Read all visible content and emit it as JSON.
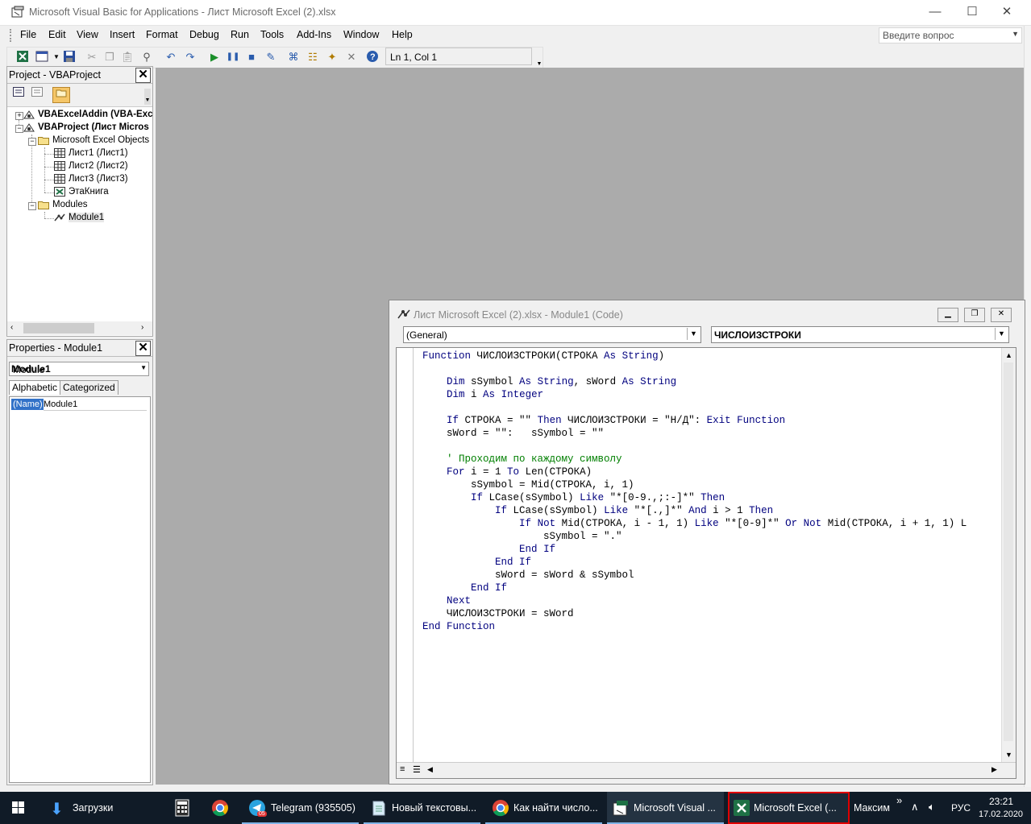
{
  "window": {
    "title": "Microsoft Visual Basic for Applications - Лист Microsoft Excel (2).xlsx",
    "minimize": "—",
    "maximize": "☐",
    "close": "✕"
  },
  "menu": {
    "items": [
      "File",
      "Edit",
      "View",
      "Insert",
      "Format",
      "Debug",
      "Run",
      "Tools",
      "Add-Ins",
      "Window",
      "Help"
    ],
    "help_placeholder": "Введите вопрос"
  },
  "toolbar": {
    "position": "Ln 1, Col 1"
  },
  "project": {
    "title": "Project - VBAProject",
    "tree": [
      {
        "label": "VBAExcelAddin (VBA-Exc",
        "bold": true,
        "level": 0
      },
      {
        "label": "VBAProject (Лист Micros",
        "bold": true,
        "level": 0
      },
      {
        "label": "Microsoft Excel Objects",
        "bold": false,
        "level": 1
      },
      {
        "label": "Лист1 (Лист1)",
        "bold": false,
        "level": 2
      },
      {
        "label": "Лист2 (Лист2)",
        "bold": false,
        "level": 2
      },
      {
        "label": "Лист3 (Лист3)",
        "bold": false,
        "level": 2
      },
      {
        "label": "ЭтаКнига",
        "bold": false,
        "level": 2
      },
      {
        "label": "Modules",
        "bold": false,
        "level": 1
      },
      {
        "label": "Module1",
        "bold": false,
        "level": 2
      }
    ]
  },
  "properties": {
    "title": "Properties - Module1",
    "object_name": "Module1",
    "object_type": "Module",
    "tabs": [
      "Alphabetic",
      "Categorized"
    ],
    "rows": [
      {
        "name": "(Name)",
        "value": "Module1"
      }
    ]
  },
  "code_window": {
    "title": "Лист Microsoft Excel (2).xlsx - Module1 (Code)",
    "object_combo": "(General)",
    "proc_combo": "ЧИСЛОИЗСТРОКИ",
    "lines": [
      "Function ЧИСЛОИЗСТРОКИ(СТРОКА As String)",
      "",
      "    Dim sSymbol As String, sWord As String",
      "    Dim i As Integer",
      "",
      "    If СТРОКА = \"\" Then ЧИСЛОИЗСТРОКИ = \"Н/Д\": Exit Function",
      "    sWord = \"\":   sSymbol = \"\"",
      "",
      "    ' Проходим по каждому символу",
      "    For i = 1 To Len(СТРОКА)",
      "        sSymbol = Mid(СТРОКА, i, 1)",
      "        If LCase(sSymbol) Like \"*[0-9.,;:-]*\" Then",
      "            If LCase(sSymbol) Like \"*[.,]*\" And i > 1 Then",
      "                If Not Mid(СТРОКА, i - 1, 1) Like \"*[0-9]*\" Or Not Mid(СТРОКА, i + 1, 1) L",
      "                    sSymbol = \".\"",
      "                End If",
      "            End If",
      "            sWord = sWord & sSymbol",
      "        End If",
      "    Next",
      "    ЧИСЛОИЗСТРОКИ = sWord",
      "End Function"
    ]
  },
  "taskbar": {
    "items": [
      {
        "label": "Загрузки",
        "icon": "download-icon"
      },
      {
        "label": "",
        "icon": "calculator-icon"
      },
      {
        "label": "",
        "icon": "chrome-icon"
      },
      {
        "label": "Telegram (935505)",
        "icon": "telegram-icon",
        "badge": "05"
      },
      {
        "label": "Новый текстовы...",
        "icon": "notepad-icon"
      },
      {
        "label": "Как найти число...",
        "icon": "chrome-icon"
      },
      {
        "label": "Microsoft Visual ...",
        "icon": "vba-icon"
      },
      {
        "label": "Microsoft Excel (...",
        "icon": "excel-icon"
      }
    ],
    "user": "Максим",
    "chevron": "»",
    "lang": "РУС",
    "time": "23:21",
    "date": "17.02.2020",
    "highlight_color": "#e00000"
  }
}
